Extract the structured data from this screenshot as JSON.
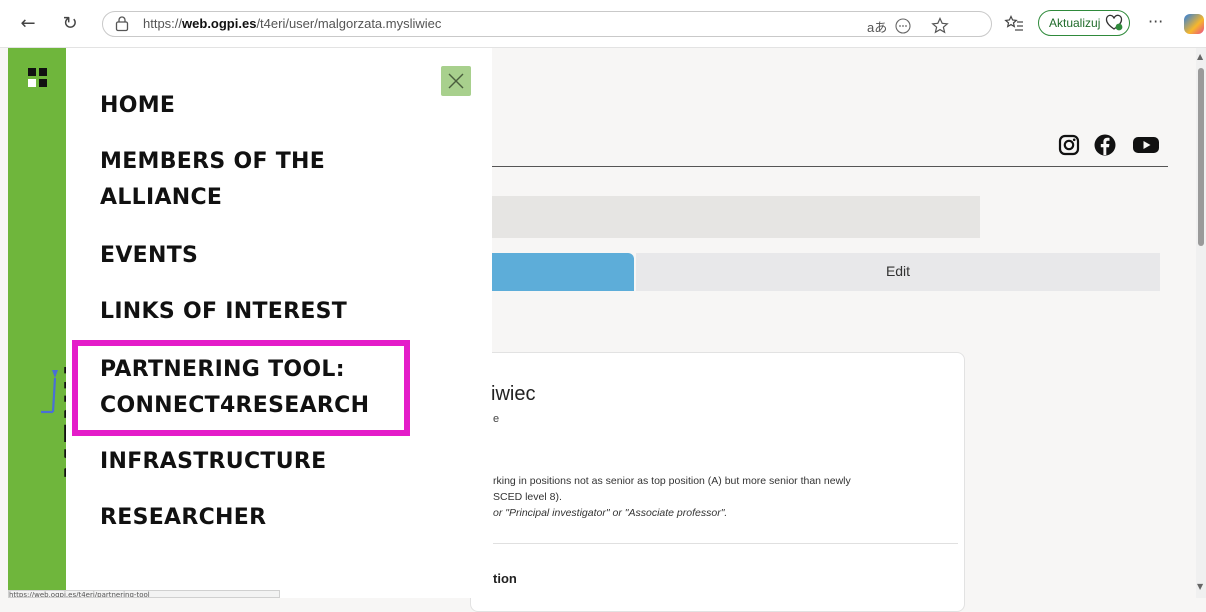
{
  "browser": {
    "url_prefix": "https://",
    "url_domain": "web.ogpi.es",
    "url_path": "/t4eri/user/malgorzata.mysliwiec",
    "read_aloud_glyph": "aあ",
    "update_label": "Aktualizuj",
    "more_label": "···",
    "status_url": "https://web.ogpi.es/t4eri/partnering-tool"
  },
  "page": {
    "edit_tab_label": "Edit",
    "profile_name_fragment": "iwiec",
    "profile_sub_fragment": "e",
    "description_line1": "rking in positions not as senior as top position (A) but more senior than newly",
    "description_line2": "SCED level 8).",
    "description_line3": "or \"Principal investigator\" or \"Associate professor\".",
    "section_fragment": "tion",
    "social_icons": [
      "instagram-icon",
      "facebook-icon",
      "youtube-icon"
    ]
  },
  "menu": {
    "vertical_label": "MENU",
    "items": [
      {
        "label_lines": [
          "HOME"
        ]
      },
      {
        "label_lines": [
          "MEMBERS OF THE",
          "ALLIANCE"
        ]
      },
      {
        "label_lines": [
          "EVENTS"
        ]
      },
      {
        "label_lines": [
          "LINKS OF INTEREST"
        ]
      },
      {
        "label_lines": [
          "PARTNERING TOOL:",
          "CONNECT4RESEARCH"
        ],
        "highlighted": true
      },
      {
        "label_lines": [
          "INFRASTRUCTURE"
        ]
      },
      {
        "label_lines": [
          "RESEARCHER"
        ]
      }
    ]
  },
  "colors": {
    "menu_green": "#6fb63c",
    "close_green": "#a8d08d",
    "highlight_magenta": "#e41dc9",
    "tab_blue": "#5dadd9"
  }
}
